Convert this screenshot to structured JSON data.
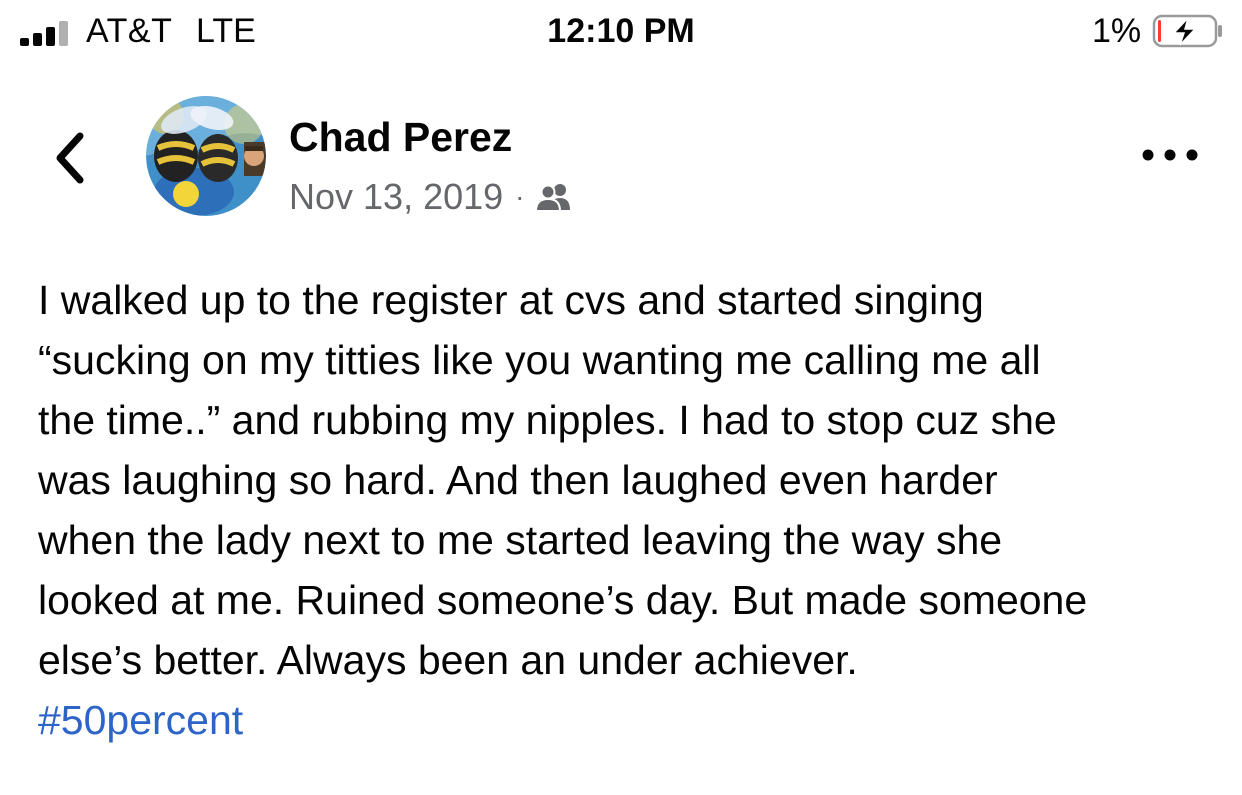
{
  "status_bar": {
    "carrier": "AT&T",
    "network": "LTE",
    "time": "12:10 PM",
    "battery_percent": "1%",
    "signal_bars_active": 3,
    "signal_bars_total": 4,
    "battery_level": 0.01,
    "battery_state": "charging",
    "colors": {
      "foreground": "#050505",
      "inactive_signal": "#b0b0b0",
      "battery_low": "#ff3b30"
    },
    "icons": [
      "signal-icon",
      "battery-charging-icon"
    ]
  },
  "post": {
    "author": "Chad Perez",
    "date": "Nov 13, 2019",
    "separator": "·",
    "audience_icon": "friends-icon",
    "lines": [
      "I walked up to the register at cvs and started singing",
      "“sucking on my titties like you wanting me calling me all",
      "the time..” and rubbing my nipples. I had to stop cuz she",
      "was laughing so hard. And then laughed even harder",
      "when the lady next to me started leaving the way she",
      "looked at me. Ruined someone’s day. But made someone",
      "else’s better. Always been an under achiever."
    ],
    "hashtag": "#50percent",
    "colors": {
      "text": "#050505",
      "meta_text": "#65676b",
      "hashtag": "#2d64c8"
    }
  },
  "header": {
    "back_icon": "chevron-left-icon",
    "more_icon": "more-horizontal-icon"
  }
}
